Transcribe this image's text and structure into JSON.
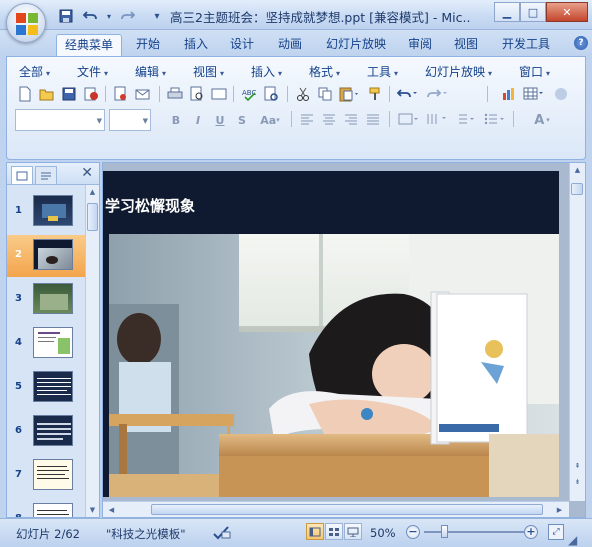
{
  "window": {
    "title": "高三2主题班会：坚持成就梦想.ppt [兼容模式] - Mic...",
    "minimize": "▁",
    "maximize": "□",
    "close": "✕"
  },
  "qat": {
    "save": "💾",
    "undo": "↶",
    "redo": "↷",
    "customize": "▾"
  },
  "tabs": [
    {
      "label": "经典菜单"
    },
    {
      "label": "开始"
    },
    {
      "label": "插入"
    },
    {
      "label": "设计"
    },
    {
      "label": "动画"
    },
    {
      "label": "幻灯片放映"
    },
    {
      "label": "审阅"
    },
    {
      "label": "视图"
    },
    {
      "label": "开发工具"
    }
  ],
  "help": "?",
  "menus": [
    {
      "label": "全部"
    },
    {
      "label": "文件"
    },
    {
      "label": "编辑"
    },
    {
      "label": "视图"
    },
    {
      "label": "插入"
    },
    {
      "label": "格式"
    },
    {
      "label": "工具"
    },
    {
      "label": "幻灯片放映"
    },
    {
      "label": "窗口"
    }
  ],
  "format": {
    "bold": "B",
    "italic": "I",
    "underline": "U",
    "strike": "S",
    "case": "Aa",
    "font_color": "A"
  },
  "slides_pane": {
    "close": "✕",
    "thumbnails": [
      {
        "num": "1"
      },
      {
        "num": "2"
      },
      {
        "num": "3"
      },
      {
        "num": "4"
      },
      {
        "num": "5"
      },
      {
        "num": "6"
      },
      {
        "num": "7"
      },
      {
        "num": "8"
      }
    ]
  },
  "slide": {
    "title": "学习松懈现象"
  },
  "status": {
    "slide_info": "幻灯片 2/62",
    "theme": "\"科技之光模板\"",
    "zoom": "50%",
    "zoom_minus": "−",
    "zoom_plus": "+",
    "zoom_level": 0.5
  },
  "colors": {
    "accent": "#15428b",
    "selected_thumb": "#f3a54c",
    "slide_bg": "#0f1a30"
  }
}
